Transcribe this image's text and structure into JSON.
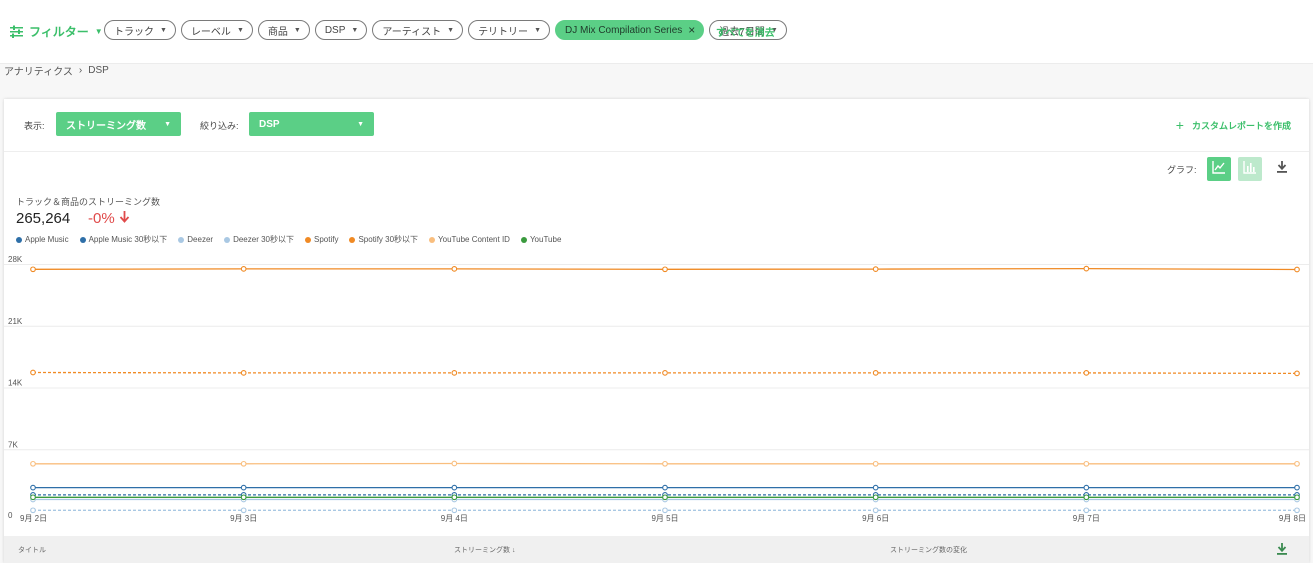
{
  "filters": {
    "toggle_label": "フィルター",
    "chips": [
      {
        "label": "トラック",
        "active": false
      },
      {
        "label": "レーベル",
        "active": false
      },
      {
        "label": "商品",
        "active": false
      },
      {
        "label": "DSP",
        "active": false
      },
      {
        "label": "アーティスト",
        "active": false
      },
      {
        "label": "テリトリー",
        "active": false
      },
      {
        "label": "DJ Mix Compilation Series",
        "active": true
      },
      {
        "label": "過去7日間",
        "active": false
      }
    ],
    "clear_all": "すべてを消去"
  },
  "breadcrumb": {
    "root": "アナリティクス",
    "current": "DSP"
  },
  "controls": {
    "view_label": "表示:",
    "view_value": "ストリーミング数",
    "narrow_label": "絞り込み:",
    "narrow_value": "DSP",
    "custom_report": "カスタムレポートを作成"
  },
  "graph": {
    "label": "グラフ:",
    "mode": "line"
  },
  "summary": {
    "title": "トラック＆商品のストリーミング数",
    "total": "265,264",
    "change": "-0%",
    "change_direction": "down",
    "change_color": "#e04a4a"
  },
  "accent_color": "#5bcf86",
  "chart_data": {
    "type": "line",
    "x": [
      "9月 2日",
      "9月 3日",
      "9月 4日",
      "9月 5日",
      "9月 6日",
      "9月 7日",
      "9月 8日"
    ],
    "ylim": [
      0,
      28000
    ],
    "y_ticks": [
      0,
      7000,
      14000,
      21000,
      28000
    ],
    "y_tick_labels": [
      "0",
      "7K",
      "14K",
      "21K",
      "28K"
    ],
    "grid": true,
    "legend_position": "top-left",
    "series": [
      {
        "name": "Apple Music",
        "color": "#2e6fa8",
        "dashed": false,
        "values": [
          2650,
          2650,
          2650,
          2650,
          2650,
          2650,
          2650
        ]
      },
      {
        "name": "Apple Music 30秒以下",
        "color": "#2e6fa8",
        "dashed": true,
        "values": [
          1820,
          1820,
          1820,
          1820,
          1820,
          1820,
          1820
        ]
      },
      {
        "name": "Deezer",
        "color": "#a9c8e3",
        "dashed": false,
        "values": [
          1300,
          1300,
          1300,
          1300,
          1300,
          1300,
          1300
        ]
      },
      {
        "name": "Deezer 30秒以下",
        "color": "#a9c8e3",
        "dashed": true,
        "values": [
          80,
          80,
          80,
          80,
          80,
          80,
          80
        ]
      },
      {
        "name": "Spotify",
        "color": "#f08a24",
        "dashed": false,
        "values": [
          27400,
          27450,
          27450,
          27400,
          27420,
          27480,
          27380
        ]
      },
      {
        "name": "Spotify 30秒以下",
        "color": "#f08a24",
        "dashed": true,
        "values": [
          15700,
          15650,
          15650,
          15650,
          15650,
          15650,
          15600
        ]
      },
      {
        "name": "YouTube Content ID",
        "color": "#f9be7e",
        "dashed": false,
        "values": [
          5350,
          5350,
          5380,
          5350,
          5350,
          5350,
          5350
        ]
      },
      {
        "name": "YouTube",
        "color": "#3a9a3e",
        "dashed": false,
        "values": [
          1550,
          1550,
          1550,
          1550,
          1550,
          1550,
          1550
        ]
      }
    ]
  },
  "table": {
    "col_title": "タイトル",
    "col_streams": "ストリーミング数",
    "col_change": "ストリーミング数の変化"
  }
}
